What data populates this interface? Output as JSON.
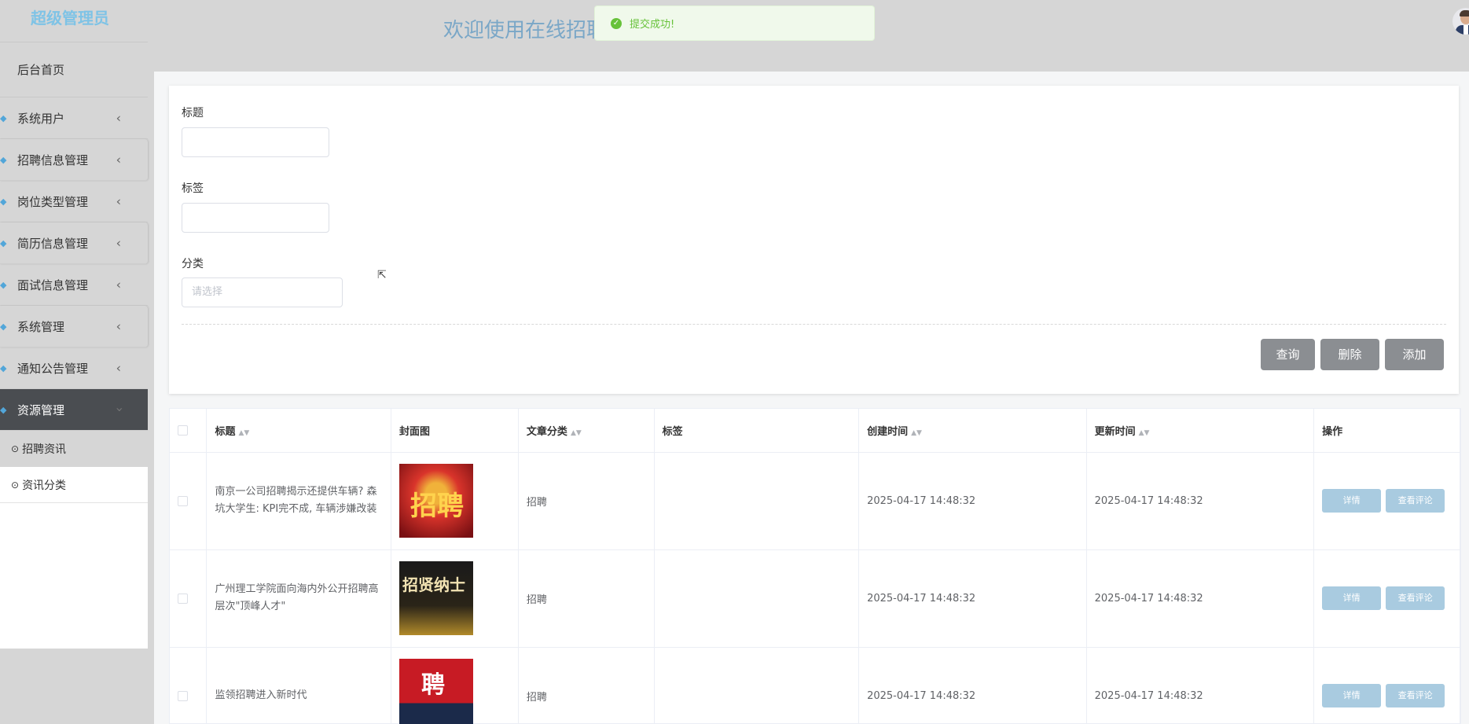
{
  "sidebar": {
    "title": "超级管理员",
    "home": "后台首页",
    "menus": [
      {
        "label": "系统用户"
      },
      {
        "label": "招聘信息管理"
      },
      {
        "label": "岗位类型管理"
      },
      {
        "label": "简历信息管理"
      },
      {
        "label": "面试信息管理"
      },
      {
        "label": "系统管理"
      },
      {
        "label": "通知公告管理"
      },
      {
        "label": "资源管理"
      }
    ],
    "submenus": [
      {
        "label": "招聘资讯"
      },
      {
        "label": "资讯分类"
      }
    ]
  },
  "header": {
    "welcome": "欢迎使用在线招聘",
    "toast": "提交成功!"
  },
  "search": {
    "title_label": "标题",
    "tag_label": "标签",
    "category_label": "分类",
    "category_placeholder": "请选择",
    "query_btn": "查询",
    "delete_btn": "删除",
    "add_btn": "添加"
  },
  "table": {
    "headers": {
      "title": "标题",
      "cover": "封面图",
      "category": "文章分类",
      "tag": "标签",
      "created": "创建时间",
      "updated": "更新时间",
      "actions": "操作"
    },
    "rows": [
      {
        "title": "南京一公司招聘揭示还提供车辆? 森坑大学生: KPI完不成, 车辆涉嫌改装",
        "category": "招聘",
        "tag": "",
        "created": "2025-04-17 14:48:32",
        "updated": "2025-04-17 14:48:32",
        "detail": "详情",
        "comments": "查看评论"
      },
      {
        "title": "广州理工学院面向海内外公开招聘高层次\"顶峰人才\"",
        "category": "招聘",
        "tag": "",
        "created": "2025-04-17 14:48:32",
        "updated": "2025-04-17 14:48:32",
        "detail": "详情",
        "comments": "查看评论"
      },
      {
        "title": "监领招聘进入新时代",
        "category": "招聘",
        "tag": "",
        "created": "2025-04-17 14:48:32",
        "updated": "2025-04-17 14:48:32",
        "detail": "详情",
        "comments": "查看评论"
      }
    ],
    "covers": [
      {
        "text": "招聘"
      },
      {
        "text": "招贤纳士"
      },
      {
        "text": "聘"
      }
    ]
  },
  "colors": {
    "accent": "#7ec3e6",
    "toast_bg": "#f0f9eb",
    "toast_text": "#67c23a",
    "button_gray": "#8b8e92",
    "action_blue": "#a9cbe0",
    "sidebar_active": "#4a4d51"
  }
}
